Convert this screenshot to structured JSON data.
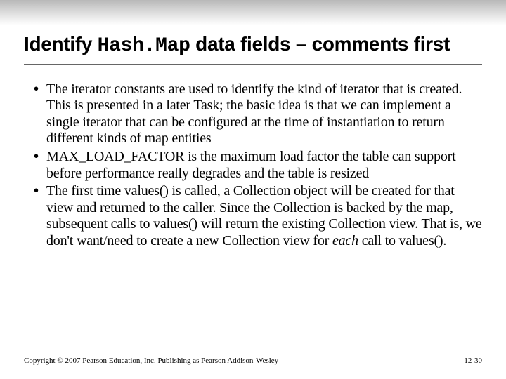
{
  "title": {
    "pre": "Identify ",
    "code": "Hash.Map",
    "post": " data fields – comments first"
  },
  "bullets": [
    "The iterator constants are used to identify the kind of iterator that is created. This is presented in a later Task; the basic idea is that we can implement a single iterator that can be configured at the time of instantiation to return different kinds of map entities",
    "MAX_LOAD_FACTOR is the maximum load factor the table can support before performance really degrades and the table is resized",
    "The first time values() is called, a Collection object will be created for that view and returned to the caller. Since the Collection is backed by the map, subsequent calls to values() will return the existing Collection view. That is, we don't want/need to create a new Collection view for "
  ],
  "bullet3_em": "each",
  "bullet3_tail": " call to values().",
  "footer": {
    "left": "Copyright © 2007 Pearson Education, Inc. Publishing as Pearson Addison-Wesley",
    "right": "12-30"
  }
}
